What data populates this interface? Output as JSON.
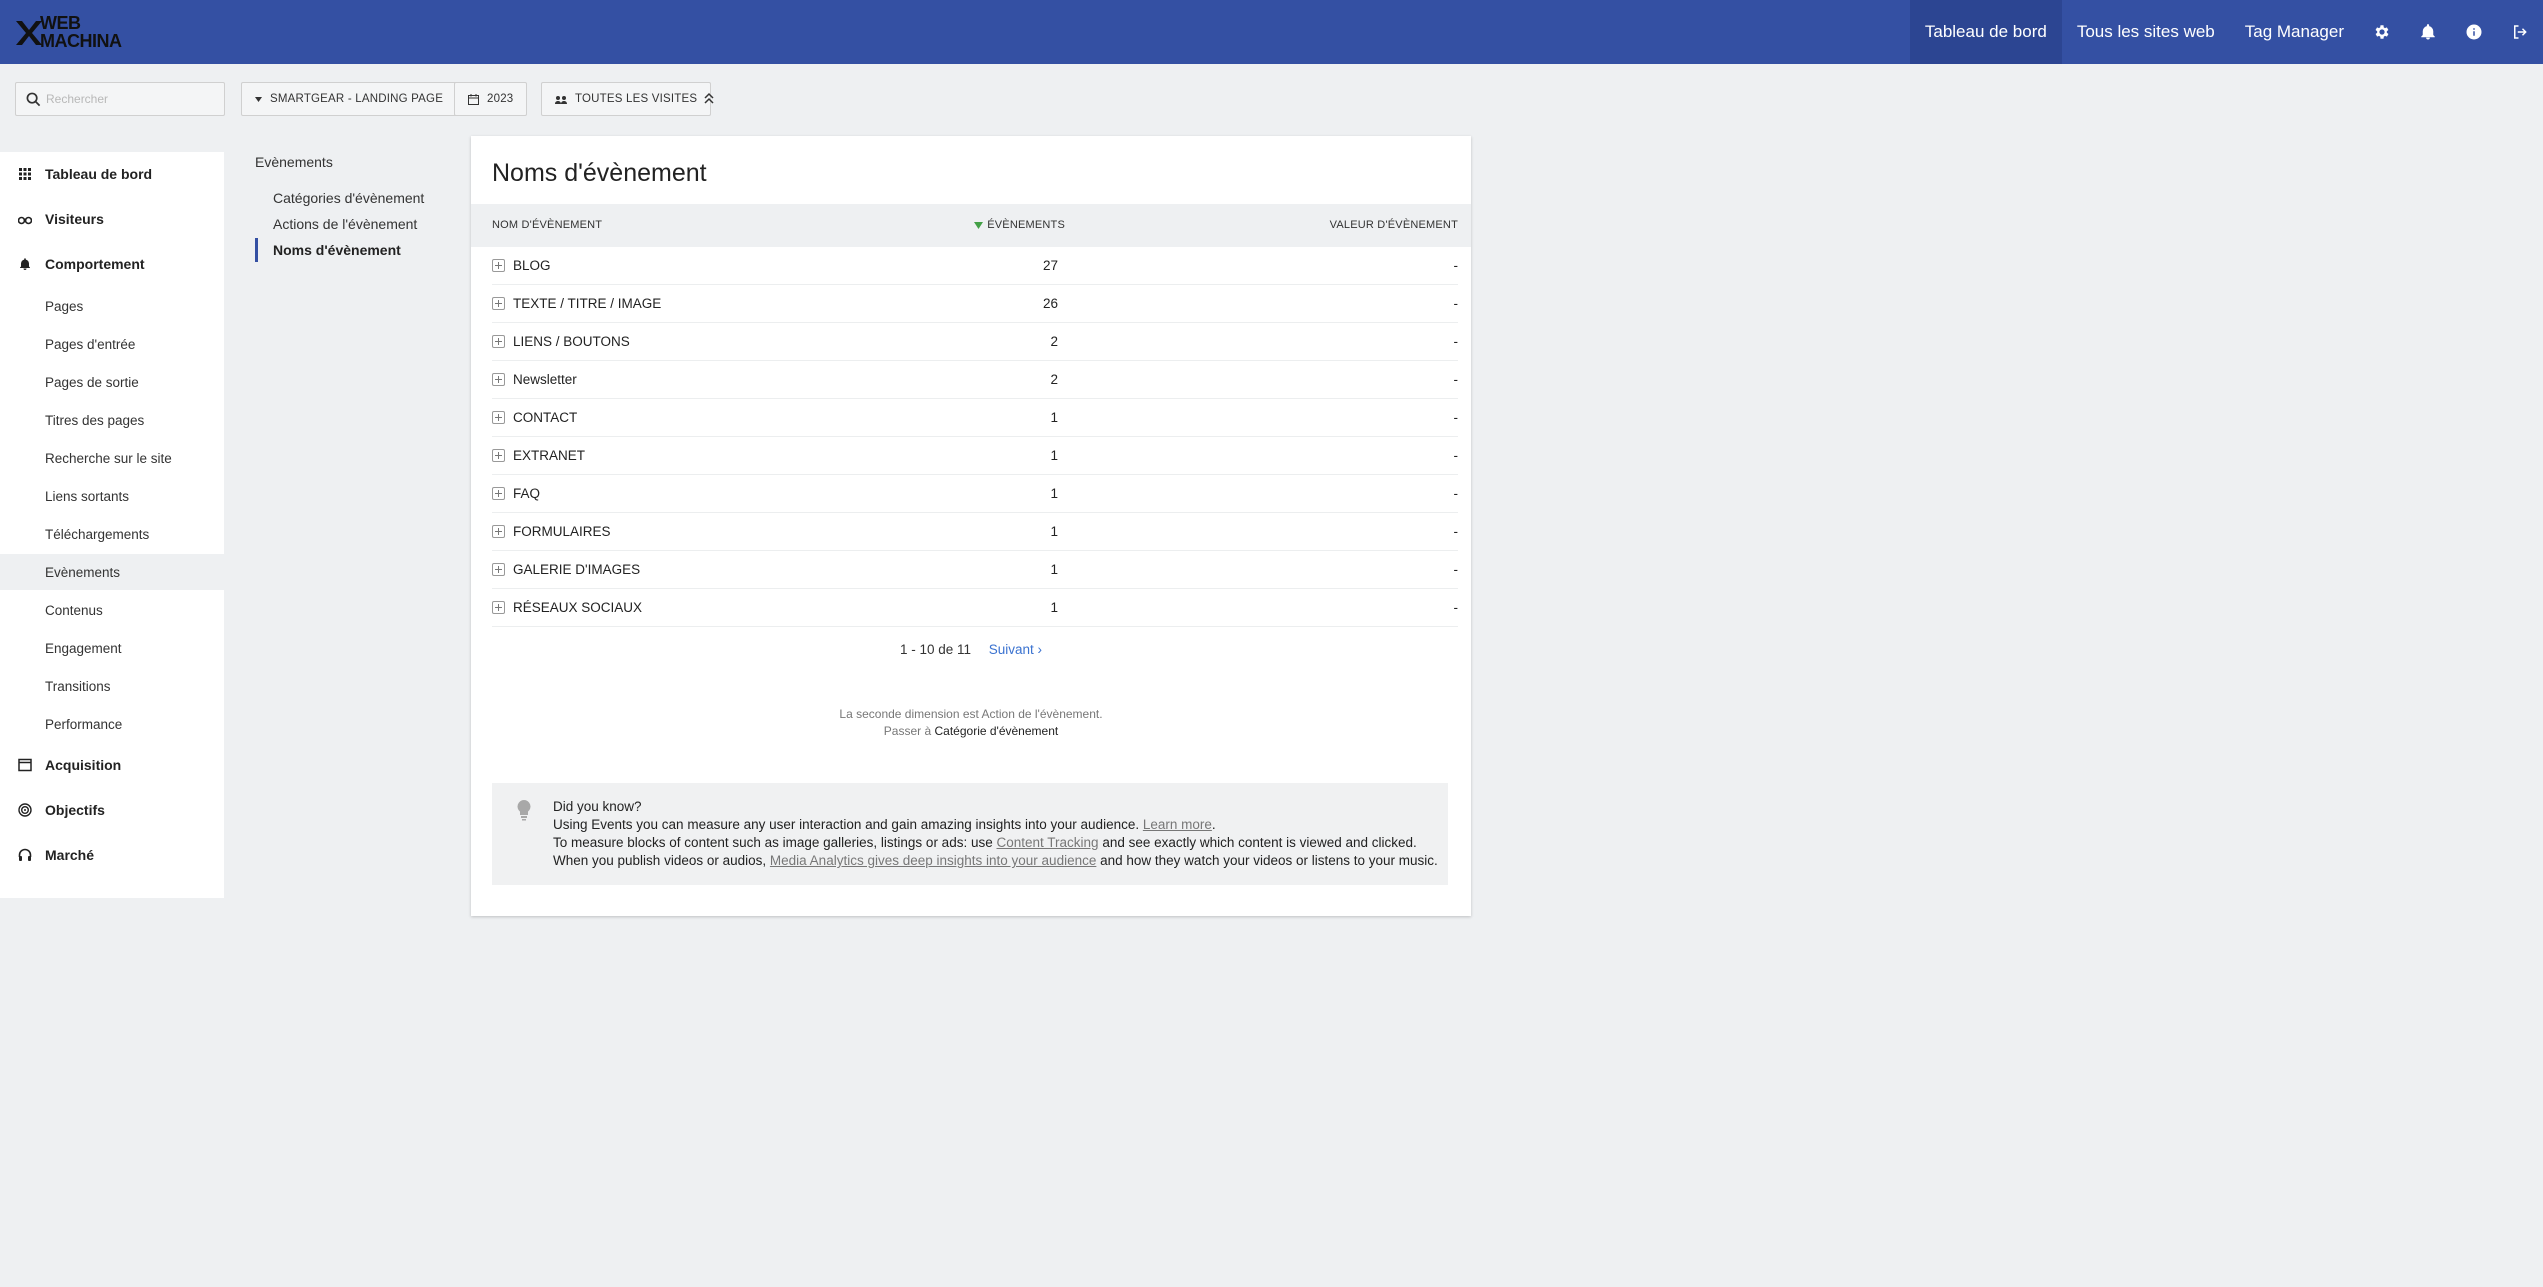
{
  "brand": {
    "line1": "WEB",
    "line2": "MACHINA"
  },
  "topnav": {
    "links": [
      "Tableau de bord",
      "Tous les sites web",
      "Tag Manager"
    ],
    "icons": [
      "gear-icon",
      "bell-icon",
      "info-icon",
      "logout-icon"
    ]
  },
  "search": {
    "placeholder": "Rechercher",
    "value": ""
  },
  "filters": {
    "site": "SMARTGEAR - LANDING PAGE",
    "period": "2023",
    "segment": "TOUTES LES VISITES"
  },
  "menu": {
    "dashboard": "Tableau de bord",
    "visitors": "Visiteurs",
    "behaviour": "Comportement",
    "behaviour_items": [
      "Pages",
      "Pages d'entrée",
      "Pages de sortie",
      "Titres des pages",
      "Recherche sur le site",
      "Liens sortants",
      "Téléchargements",
      "Evènements",
      "Contenus",
      "Engagement",
      "Transitions",
      "Performance"
    ],
    "acquisition": "Acquisition",
    "goals": "Objectifs",
    "marketplace": "Marché"
  },
  "subnav": {
    "heading": "Evènements",
    "items": [
      "Catégories d'évènement",
      "Actions de l'évènement",
      "Noms d'évènement"
    ]
  },
  "report": {
    "title": "Noms d'évènement",
    "columns": {
      "name": "NOM D'ÉVÈNEMENT",
      "events": "ÉVÈNEMENTS",
      "value": "VALEUR D'ÉVÈNEMENT"
    },
    "rows": [
      {
        "name": "BLOG",
        "events": "27",
        "value": "-"
      },
      {
        "name": "TEXTE / TITRE / IMAGE",
        "events": "26",
        "value": "-"
      },
      {
        "name": "LIENS / BOUTONS",
        "events": "2",
        "value": "-"
      },
      {
        "name": "Newsletter",
        "events": "2",
        "value": "-"
      },
      {
        "name": "CONTACT",
        "events": "1",
        "value": "-"
      },
      {
        "name": "EXTRANET",
        "events": "1",
        "value": "-"
      },
      {
        "name": "FAQ",
        "events": "1",
        "value": "-"
      },
      {
        "name": "FORMULAIRES",
        "events": "1",
        "value": "-"
      },
      {
        "name": "GALERIE D'IMAGES",
        "events": "1",
        "value": "-"
      },
      {
        "name": "RÉSEAUX SOCIAUX",
        "events": "1",
        "value": "-"
      }
    ],
    "pagination": {
      "range": "1 - 10 de 11",
      "next": "Suivant ›"
    },
    "secondary": {
      "line1": "La seconde dimension est Action de l'évènement.",
      "switch_prefix": "Passer à",
      "switch_link": "Catégorie d'évènement"
    },
    "tip": {
      "heading": "Did you know?",
      "line2_text": "Using Events you can measure any user interaction and gain amazing insights into your audience.",
      "line2_link": "Learn more",
      "line3_pre": "To measure blocks of content such as image galleries, listings or ads: use",
      "line3_link": "Content Tracking",
      "line3_post": "and see exactly which content is viewed and clicked.",
      "line4_pre": "When you publish videos or audios,",
      "line4_link": "Media Analytics gives deep insights into your audience",
      "line4_post": "and how they watch your videos or listens to your music."
    }
  }
}
